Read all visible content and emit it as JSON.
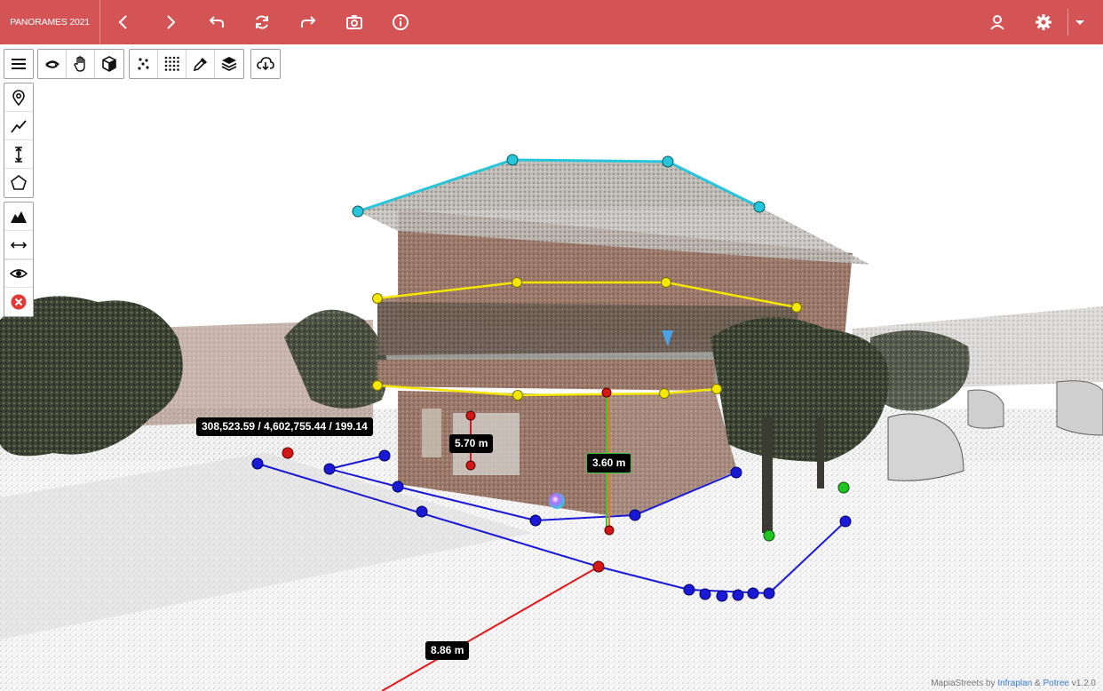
{
  "app": {
    "title": "PANORAMES 2021"
  },
  "topbar": {
    "icons": [
      "chevron-left-icon",
      "chevron-right-icon",
      "undo-icon",
      "refresh-icon",
      "redo-icon",
      "camera-icon",
      "info-icon",
      "user-icon",
      "gear-icon",
      "caret-down-icon"
    ]
  },
  "toolbar": {
    "groups": [
      [
        "menu-icon"
      ],
      [
        "orbit-icon",
        "pan-hand-icon",
        "cube-icon"
      ],
      [
        "points-sparse-icon",
        "points-grid-icon",
        "eyedropper-icon",
        "layers-icon"
      ],
      [
        "cloud-download-icon"
      ]
    ]
  },
  "side_tools": {
    "measure": [
      "point-marker-icon",
      "polyline-icon",
      "height-icon",
      "polygon-icon"
    ],
    "profile": [
      "terrain-icon",
      "distance-icon"
    ],
    "view": [
      "eye-icon"
    ],
    "clear": [
      "clear-icon"
    ]
  },
  "measurements": {
    "coordinates": "308,523.59 / 4,602,755.44 / 199.14",
    "height_1": "5.70 m",
    "height_2": "3.60 m",
    "distance": "8.86 m"
  },
  "credit": {
    "prefix": "MapiaStreets by",
    "link1": "Infraplan",
    "amp": "&",
    "link2": "Potree",
    "version": "v1.2.0"
  },
  "colors": {
    "topbar": "#d45355",
    "roof_line": "#26c6da",
    "floor_line": "#f5e600",
    "ground_line": "#1a1ad6",
    "distance_line": "#e01818",
    "height_marker": "#d41616",
    "green_marker": "#22c422"
  }
}
